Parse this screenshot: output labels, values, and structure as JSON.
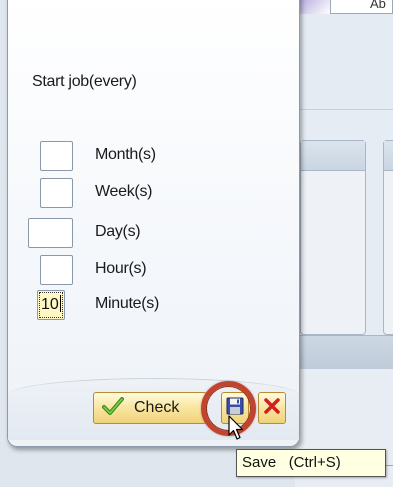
{
  "background": {
    "tab_text": "Ab"
  },
  "dialog": {
    "title": "Start job(every)",
    "fields": [
      {
        "label": "Month(s)",
        "value": ""
      },
      {
        "label": "Week(s)",
        "value": ""
      },
      {
        "label": "Day(s)",
        "value": ""
      },
      {
        "label": "Hour(s)",
        "value": ""
      },
      {
        "label": "Minute(s)",
        "value": "10"
      }
    ]
  },
  "buttons": {
    "check_label": "Check",
    "save_icon": "floppy-disk-icon",
    "cancel_icon": "red-x-icon"
  },
  "tooltip": {
    "text": "Save   (Ctrl+S)"
  },
  "colors": {
    "highlight_ring": "#c2442f",
    "button_gold": "#f1d27a",
    "tooltip_bg": "#ffffe1"
  }
}
